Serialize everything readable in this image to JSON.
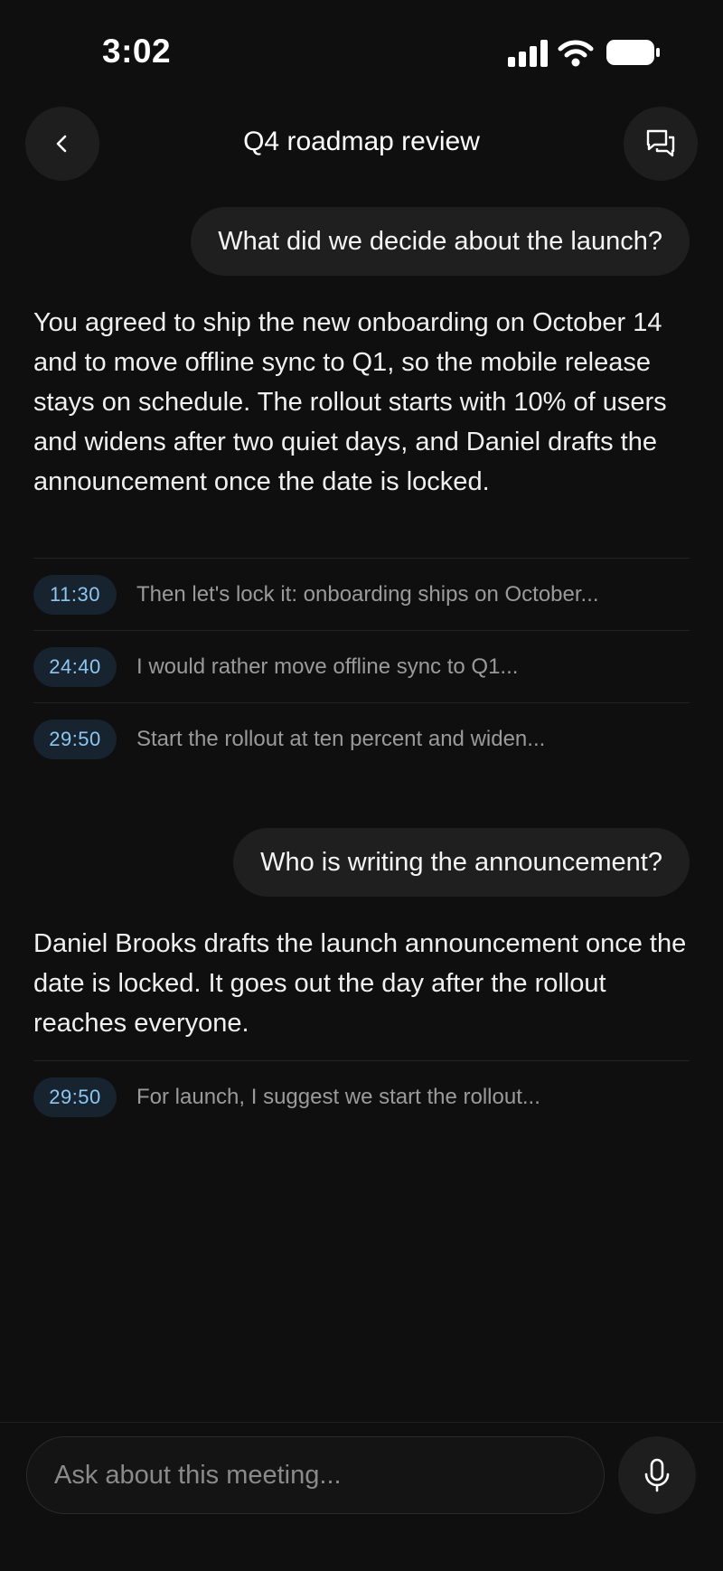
{
  "status_bar": {
    "time": "3:02",
    "icons": [
      "signal-icon",
      "wifi-icon",
      "battery-icon"
    ]
  },
  "header": {
    "title": "Q4 roadmap review",
    "back_icon": "chevron-left-icon",
    "chats_icon": "chat-bubbles-icon"
  },
  "conversation": [
    {
      "question": "What did we decide about the launch?",
      "answer": "You agreed to ship the new onboarding on October 14 and to move offline sync to Q1, so the mobile release stays on schedule. The rollout starts with 10% of users and widens after two quiet days, and Daniel drafts the announcement once the date is locked.",
      "sources": [
        {
          "timestamp": "11:30",
          "text": "Then let's lock it: onboarding ships on October..."
        },
        {
          "timestamp": "24:40",
          "text": "I would rather move offline sync to Q1..."
        },
        {
          "timestamp": "29:50",
          "text": "Start the rollout at ten percent and widen..."
        }
      ]
    },
    {
      "question": "Who is writing the announcement?",
      "answer": "Daniel Brooks drafts the launch announcement once the date is locked. It goes out the day after the rollout reaches everyone.",
      "sources": [
        {
          "timestamp": "29:50",
          "text": "For launch, I suggest we start the rollout..."
        }
      ]
    }
  ],
  "composer": {
    "placeholder": "Ask about this meeting...",
    "mic_icon": "microphone-icon"
  },
  "colors": {
    "background": "#0f0f0f",
    "bubble": "#1f1f1f",
    "timestamp_pill_bg": "#172430",
    "timestamp_text": "#8cc6f2",
    "source_text": "#9a9a9a"
  }
}
